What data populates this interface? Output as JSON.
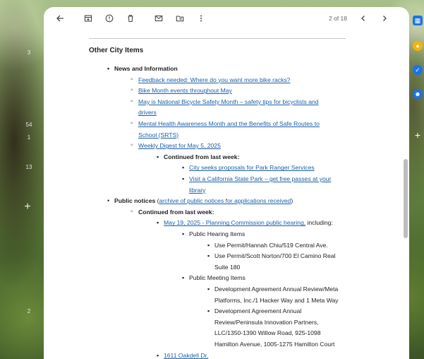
{
  "rail": {
    "counts": [
      "3",
      "54",
      "1",
      "13",
      "2"
    ]
  },
  "toolbar": {
    "counter": "2 of 18"
  },
  "email": {
    "section_title": "Other City Items",
    "news_heading": "News and Information",
    "news_links": {
      "bike_racks": "Feedback needed: Where do you want more bike racks?",
      "bike_month": "Bike Month events throughout May",
      "safety_line1": "May is National Bicycle Safety Month – safety tips for bicyclists and",
      "safety_line2": "drivers",
      "mental_line1": "Mental Health Awareness Month and the Benefits of Safe Routes to",
      "mental_line2": "School (SRTS)",
      "digest": "Weekly Digest for May 5, 2025"
    },
    "continued_label": "Continued from last week:",
    "continued_links": {
      "ranger": "City seeks proposals for Park Ranger Services",
      "state_park_line1": "Visit a California State Park – get free passes at your",
      "state_park_line2": "library"
    },
    "public_notices": {
      "heading": "Public notices",
      "paren_open": "(",
      "archive_link": "archive of public notices for applications received",
      "paren_close": ")",
      "continued_label": "Continued from last week:",
      "hearing_link": "May 19, 2025 - Planning Commission public hearing,",
      "hearing_suffix": " including:",
      "hearing_items_label": "Public Hearing Items",
      "hearing_items": {
        "chiu": "Use Permit/Hannah Chiu/519 Central Ave.",
        "norton_line1": "Use Permit/Scott Norton/700 El Camino Real",
        "norton_line2": "Suite 180"
      },
      "meeting_items_label": "Public Meeting Items",
      "meeting_items": {
        "meta_line1": "Development Agreement Annual Review/Meta",
        "meta_line2": "Platforms, Inc./1 Hacker Way and 1 Meta Way",
        "pen_line1": "Development Agreement Annual",
        "pen_line2": "Review/Peninsula Innovation Partners,",
        "pen_line3": "LLC/1350-1390 Willow Road, 925-1098",
        "pen_line4": "Hamilton Avenue, 1005-1275 Hamilton Court"
      },
      "oakdell_link": "1611 Oakdell Dr."
    }
  }
}
